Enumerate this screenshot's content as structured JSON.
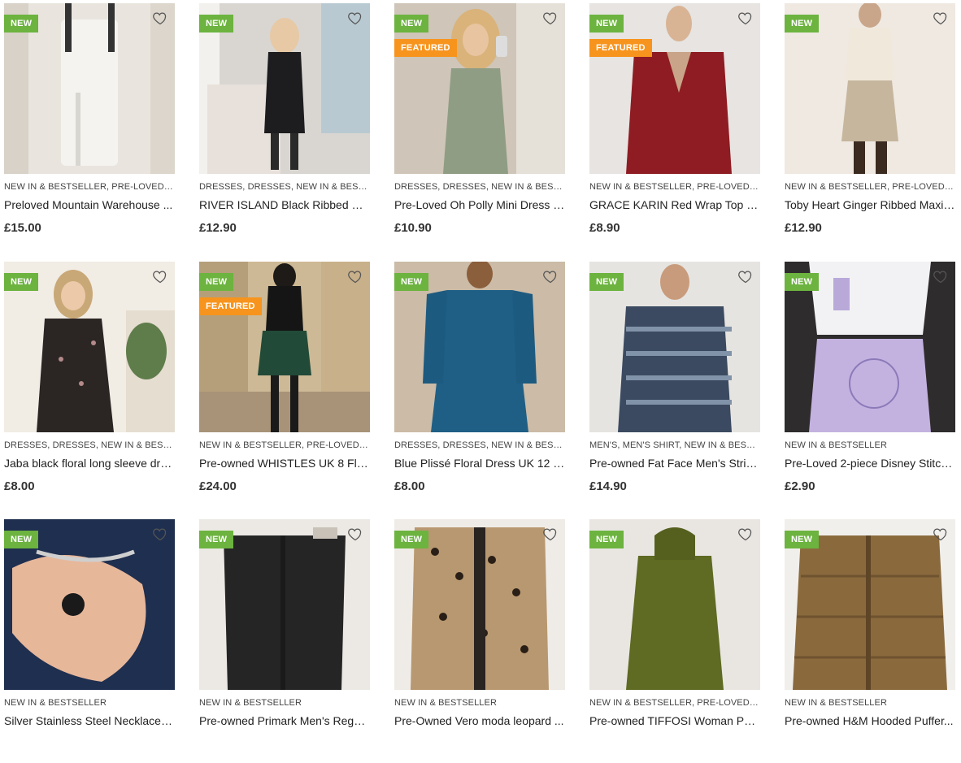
{
  "badges": {
    "new": "NEW",
    "featured": "FEATURED"
  },
  "colors": {
    "new_badge": "#6cb33f",
    "featured_badge": "#f7941d",
    "heart_outline": "#555555"
  },
  "icons": {
    "wishlist": "heart-outline-icon"
  },
  "products": [
    {
      "categories": "NEW IN & BESTSELLER, PRE-LOVED, PR...",
      "title": "Preloved Mountain Warehouse ...",
      "price": "£15.00",
      "new": true,
      "featured": false
    },
    {
      "categories": "DRESSES, DRESSES, NEW IN & BESTSEL...",
      "title": "RIVER ISLAND Black Ribbed Bo...",
      "price": "£12.90",
      "new": true,
      "featured": false
    },
    {
      "categories": "DRESSES, DRESSES, NEW IN & BESTSEL...",
      "title": "Pre-Loved Oh Polly Mini Dress U...",
      "price": "£10.90",
      "new": true,
      "featured": true
    },
    {
      "categories": "NEW IN & BESTSELLER, PRE-LOVED, PR...",
      "title": "GRACE KARIN Red Wrap Top U...",
      "price": "£8.90",
      "new": true,
      "featured": true
    },
    {
      "categories": "NEW IN & BESTSELLER, PRE-LOVED, PR...",
      "title": "Toby Heart Ginger Ribbed Maxi ...",
      "price": "£12.90",
      "new": true,
      "featured": false
    },
    {
      "categories": "DRESSES, DRESSES, NEW IN & BESTSEL...",
      "title": "Jaba black floral long sleeve dres...",
      "price": "£8.00",
      "new": true,
      "featured": false
    },
    {
      "categories": "NEW IN & BESTSELLER, PRE-LOVED, PR...",
      "title": "Pre-owned WHISTLES UK 8 Flor...",
      "price": "£24.00",
      "new": true,
      "featured": true
    },
    {
      "categories": "DRESSES, DRESSES, NEW IN & BESTSEL...",
      "title": "Blue Plissé Floral Dress UK 12 1...",
      "price": "£8.00",
      "new": true,
      "featured": false
    },
    {
      "categories": "MEN'S, MEN'S SHIRT, NEW IN & BESTS...",
      "title": "Pre-owned Fat Face Men's Strip...",
      "price": "£14.90",
      "new": true,
      "featured": false
    },
    {
      "categories": "NEW IN & BESTSELLER",
      "title": "Pre-Loved 2-piece Disney Stitch ...",
      "price": "£2.90",
      "new": true,
      "featured": false
    },
    {
      "categories": "NEW IN & BESTSELLER",
      "title": "Silver Stainless Steel Necklace – ...",
      "price": "",
      "new": true,
      "featured": false
    },
    {
      "categories": "NEW IN & BESTSELLER",
      "title": "Pre-owned Primark Men's Regul...",
      "price": "",
      "new": true,
      "featured": false
    },
    {
      "categories": "NEW IN & BESTSELLER",
      "title": "Pre-Owned Vero moda leopard ...",
      "price": "",
      "new": true,
      "featured": false
    },
    {
      "categories": "NEW IN & BESTSELLER, PRE-LOVED, PR...",
      "title": "Pre-owned TIFFOSI Woman Pad...",
      "price": "",
      "new": true,
      "featured": false
    },
    {
      "categories": "NEW IN & BESTSELLER",
      "title": "Pre-owned H&M Hooded Puffer...",
      "price": "",
      "new": true,
      "featured": false
    }
  ]
}
